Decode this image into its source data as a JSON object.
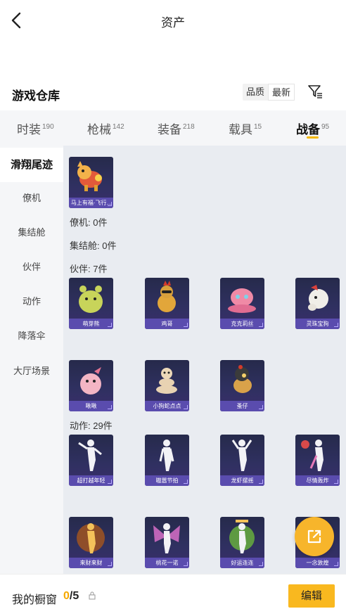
{
  "header": {
    "title": "资产"
  },
  "section": {
    "title": "游戏仓库",
    "sort_options": [
      "品质",
      "最新"
    ],
    "sort_selected": "最新"
  },
  "tabs": [
    {
      "label": "时装",
      "count": "190"
    },
    {
      "label": "枪械",
      "count": "142"
    },
    {
      "label": "装备",
      "count": "218"
    },
    {
      "label": "载具",
      "count": "15"
    },
    {
      "label": "战备",
      "count": "95",
      "active": true
    }
  ],
  "sidebar": {
    "items": [
      "滑翔尾迹",
      "僚机",
      "集结舱",
      "伙伴",
      "动作",
      "降落伞",
      "大厅场景"
    ],
    "active": "滑翔尾迹"
  },
  "groups": {
    "trail_items": [
      "马上有福·飞行..."
    ],
    "wingman_label": "僚机: 0件",
    "pod_label": "集结舱: 0件",
    "partner_label": "伙伴: 7件",
    "partner_items": [
      "萌芽熊",
      "鸡哥",
      "克克莉丝",
      "灵珠宝狗",
      "啾啾",
      "小狗蛇点点",
      "蚤仔"
    ],
    "emote_label": "动作: 29件",
    "emote_items": [
      "超打越年轻",
      "嗷嚣节拍",
      "龙虾摆摇",
      "尽情轰炸",
      "来财来财",
      "桃花一诺",
      "好运连连",
      "一念敦煌"
    ]
  },
  "bottom": {
    "label": "我的橱窗",
    "used": "0",
    "total": "/5",
    "edit_label": "编辑"
  },
  "colors": {
    "accent": "#f7b52b",
    "card_bg": "#2c2f58",
    "card_caption": "#5a4cae"
  }
}
